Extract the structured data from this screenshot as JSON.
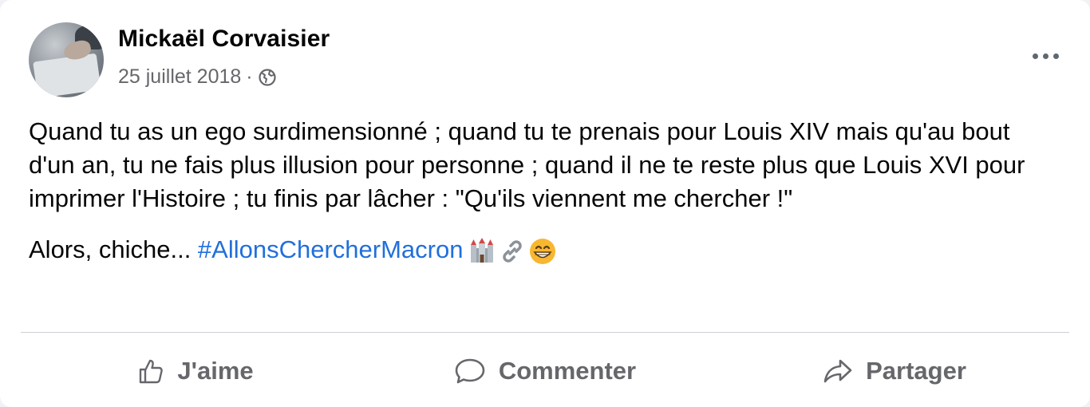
{
  "post": {
    "author": "Mickaël Corvaisier",
    "date": "25 juillet 2018",
    "separator": "·",
    "privacy_icon": "globe-icon",
    "more_icon": "more-options-icon",
    "text_paragraph_1": "Quand tu as un ego surdimensionné ; quand tu te prenais pour Louis XIV mais qu'au bout d'un an, tu ne fais plus illusion pour personne ; quand il ne te reste plus que Louis XVI pour imprimer l'Histoire ; tu finis par lâcher : \"Qu'ils viennent me chercher !\"",
    "text_paragraph_2_prefix": "Alors, chiche... ",
    "hashtag": "#AllonsChercherMacron",
    "emojis": [
      "castle-emoji",
      "link-emoji",
      "grinning-face-emoji"
    ]
  },
  "actions": {
    "like_label": "J'aime",
    "comment_label": "Commenter",
    "share_label": "Partager"
  },
  "colors": {
    "hashtag": "#216fdb",
    "secondary_text": "#65676b",
    "primary_text": "#050505"
  }
}
